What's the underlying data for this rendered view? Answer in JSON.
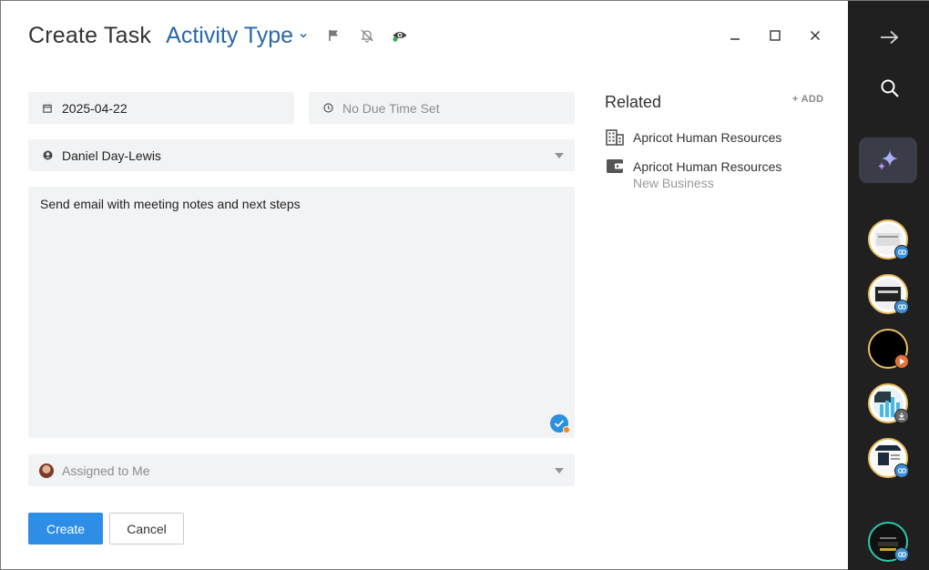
{
  "header": {
    "title": "Create Task",
    "activity_type": "Activity Type"
  },
  "form": {
    "date_value": "2025-04-22",
    "time_placeholder": "No Due Time Set",
    "contact_value": "Daniel Day-Lewis",
    "notes_value": "Send email with meeting notes and next steps",
    "assigned_placeholder": "Assigned to Me",
    "create_label": "Create",
    "cancel_label": "Cancel"
  },
  "related": {
    "title": "Related",
    "add_label": "+ ADD",
    "items": [
      {
        "label": "Apricot Human Resources",
        "icon": "building-icon"
      },
      {
        "label": "Apricot Human Resources",
        "sublabel": "New Business",
        "icon": "wallet-icon"
      }
    ]
  },
  "sidebar": {
    "thumbnails": [
      {
        "badge": "link-icon",
        "badge_color": "#3a8fd6"
      },
      {
        "badge": "link-icon",
        "badge_color": "#3a8fd6"
      },
      {
        "badge": "play-icon",
        "badge_color": "#e8703a"
      },
      {
        "badge": "download-icon",
        "badge_color": "#777777"
      },
      {
        "badge": "link-icon",
        "badge_color": "#3a8fd6"
      },
      {
        "badge": "link-icon",
        "badge_color": "#3a8fd6"
      }
    ]
  },
  "colors": {
    "accent": "#2e8ee6",
    "title_link": "#2a68a8",
    "sidebar_bg": "#202020"
  }
}
